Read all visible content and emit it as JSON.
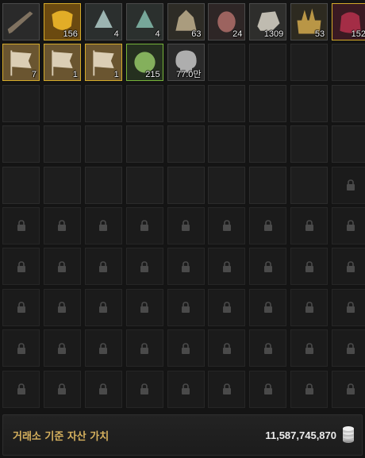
{
  "inventory": {
    "columns": 9,
    "items": [
      {
        "icon": "musket-icon",
        "quantity": "",
        "rarity": "white",
        "bg": "#2a2a2a",
        "fg": "#8a7a66"
      },
      {
        "icon": "golden-mask-icon",
        "quantity": "156",
        "rarity": "gold",
        "bg": "#6b4a10",
        "fg": "#f0b82a"
      },
      {
        "icon": "silver-gem-icon",
        "quantity": "4",
        "rarity": "white",
        "bg": "#2b2f2e",
        "fg": "#a9c3c0"
      },
      {
        "icon": "green-gem-icon",
        "quantity": "4",
        "rarity": "white",
        "bg": "#2b302e",
        "fg": "#7fb5a6"
      },
      {
        "icon": "crown-stone-icon",
        "quantity": "63",
        "rarity": "white",
        "bg": "#2e2c26",
        "fg": "#b8a888"
      },
      {
        "icon": "red-ore-icon",
        "quantity": "24",
        "rarity": "white",
        "bg": "#2e2626",
        "fg": "#a86a66"
      },
      {
        "icon": "white-ore-icon",
        "quantity": "1309",
        "rarity": "white",
        "bg": "#2e2e2c",
        "fg": "#cfcbbf"
      },
      {
        "icon": "crystal-box-icon",
        "quantity": "53",
        "rarity": "white",
        "bg": "#2d2a20",
        "fg": "#c9a24a"
      },
      {
        "icon": "crimson-bag-icon",
        "quantity": "152",
        "rarity": "gold",
        "bg": "#3a1a22",
        "fg": "#b0304a"
      },
      {
        "icon": "flag-scroll-icon",
        "quantity": "7",
        "rarity": "gold",
        "bg": "#6a5530",
        "fg": "#e8dcc4"
      },
      {
        "icon": "flag-scroll-icon",
        "quantity": "1",
        "rarity": "gold",
        "bg": "#6a5530",
        "fg": "#e8dcc4"
      },
      {
        "icon": "flag-scroll-icon",
        "quantity": "1",
        "rarity": "gold",
        "bg": "#6a5530",
        "fg": "#e8dcc4"
      },
      {
        "icon": "green-crest-icon",
        "quantity": "215",
        "rarity": "green",
        "bg": "#25301f",
        "fg": "#8fbf63"
      },
      {
        "icon": "skull-coin-icon",
        "quantity": "77.0만",
        "rarity": "white",
        "bg": "#2a2a2a",
        "fg": "#bdbdbd"
      }
    ],
    "empty_slots_count": 30,
    "add_slot_index": 43,
    "total_slots": 90
  },
  "footer": {
    "label": "거래소 기준 자산 가치",
    "value": "11,587,745,870",
    "icon": "silver-coin-stack-icon"
  },
  "colors": {
    "gold_border": "#d4aa2a",
    "green_border": "#76b33a",
    "label": "#d6b15e"
  }
}
